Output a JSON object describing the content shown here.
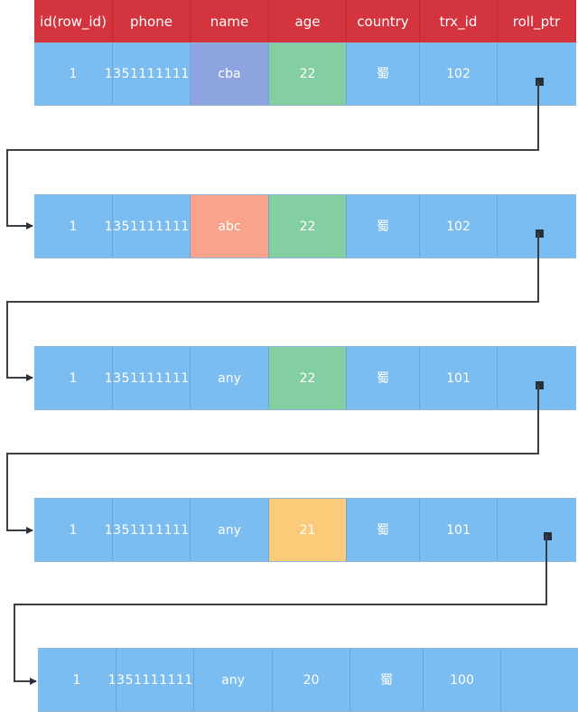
{
  "columns": [
    "id(row_id)",
    "phone",
    "name",
    "age",
    "country",
    "trx_id",
    "roll_ptr"
  ],
  "colors": {
    "header": "#d3343d",
    "cell_default": "#7bbdf0",
    "name_highlight_current": "#8da4e0",
    "name_highlight_changed": "#f9a38a",
    "age_highlight": "#84cfa2",
    "age_changed": "#fccb7a",
    "pointer": "#26313d"
  },
  "rows": [
    {
      "id": "1",
      "phone_line1": "13511111",
      "phone_line2": "111",
      "name": "cba",
      "age": "22",
      "country": "蜀",
      "trx_id": "102",
      "roll_ptr": "pointer",
      "name_color": "#8da4e0",
      "age_color": "#84cfa2"
    },
    {
      "id": "1",
      "phone_line1": "13511111",
      "phone_line2": "111",
      "name": "abc",
      "age": "22",
      "country": "蜀",
      "trx_id": "102",
      "roll_ptr": "pointer",
      "name_color": "#f9a38a",
      "age_color": "#84cfa2"
    },
    {
      "id": "1",
      "phone_line1": "13511111",
      "phone_line2": "111",
      "name": "any",
      "age": "22",
      "country": "蜀",
      "trx_id": "101",
      "roll_ptr": "pointer",
      "name_color": "#7bbdf0",
      "age_color": "#84cfa2"
    },
    {
      "id": "1",
      "phone_line1": "13511111",
      "phone_line2": "111",
      "name": "any",
      "age": "21",
      "country": "蜀",
      "trx_id": "101",
      "roll_ptr": "pointer",
      "name_color": "#7bbdf0",
      "age_color": "#fccb7a"
    },
    {
      "id": "1",
      "phone_line1": "13511111",
      "phone_line2": "111",
      "name": "any",
      "age": "20",
      "country": "蜀",
      "trx_id": "100",
      "roll_ptr": "",
      "name_color": "#7bbdf0",
      "age_color": "#7bbdf0"
    }
  ]
}
